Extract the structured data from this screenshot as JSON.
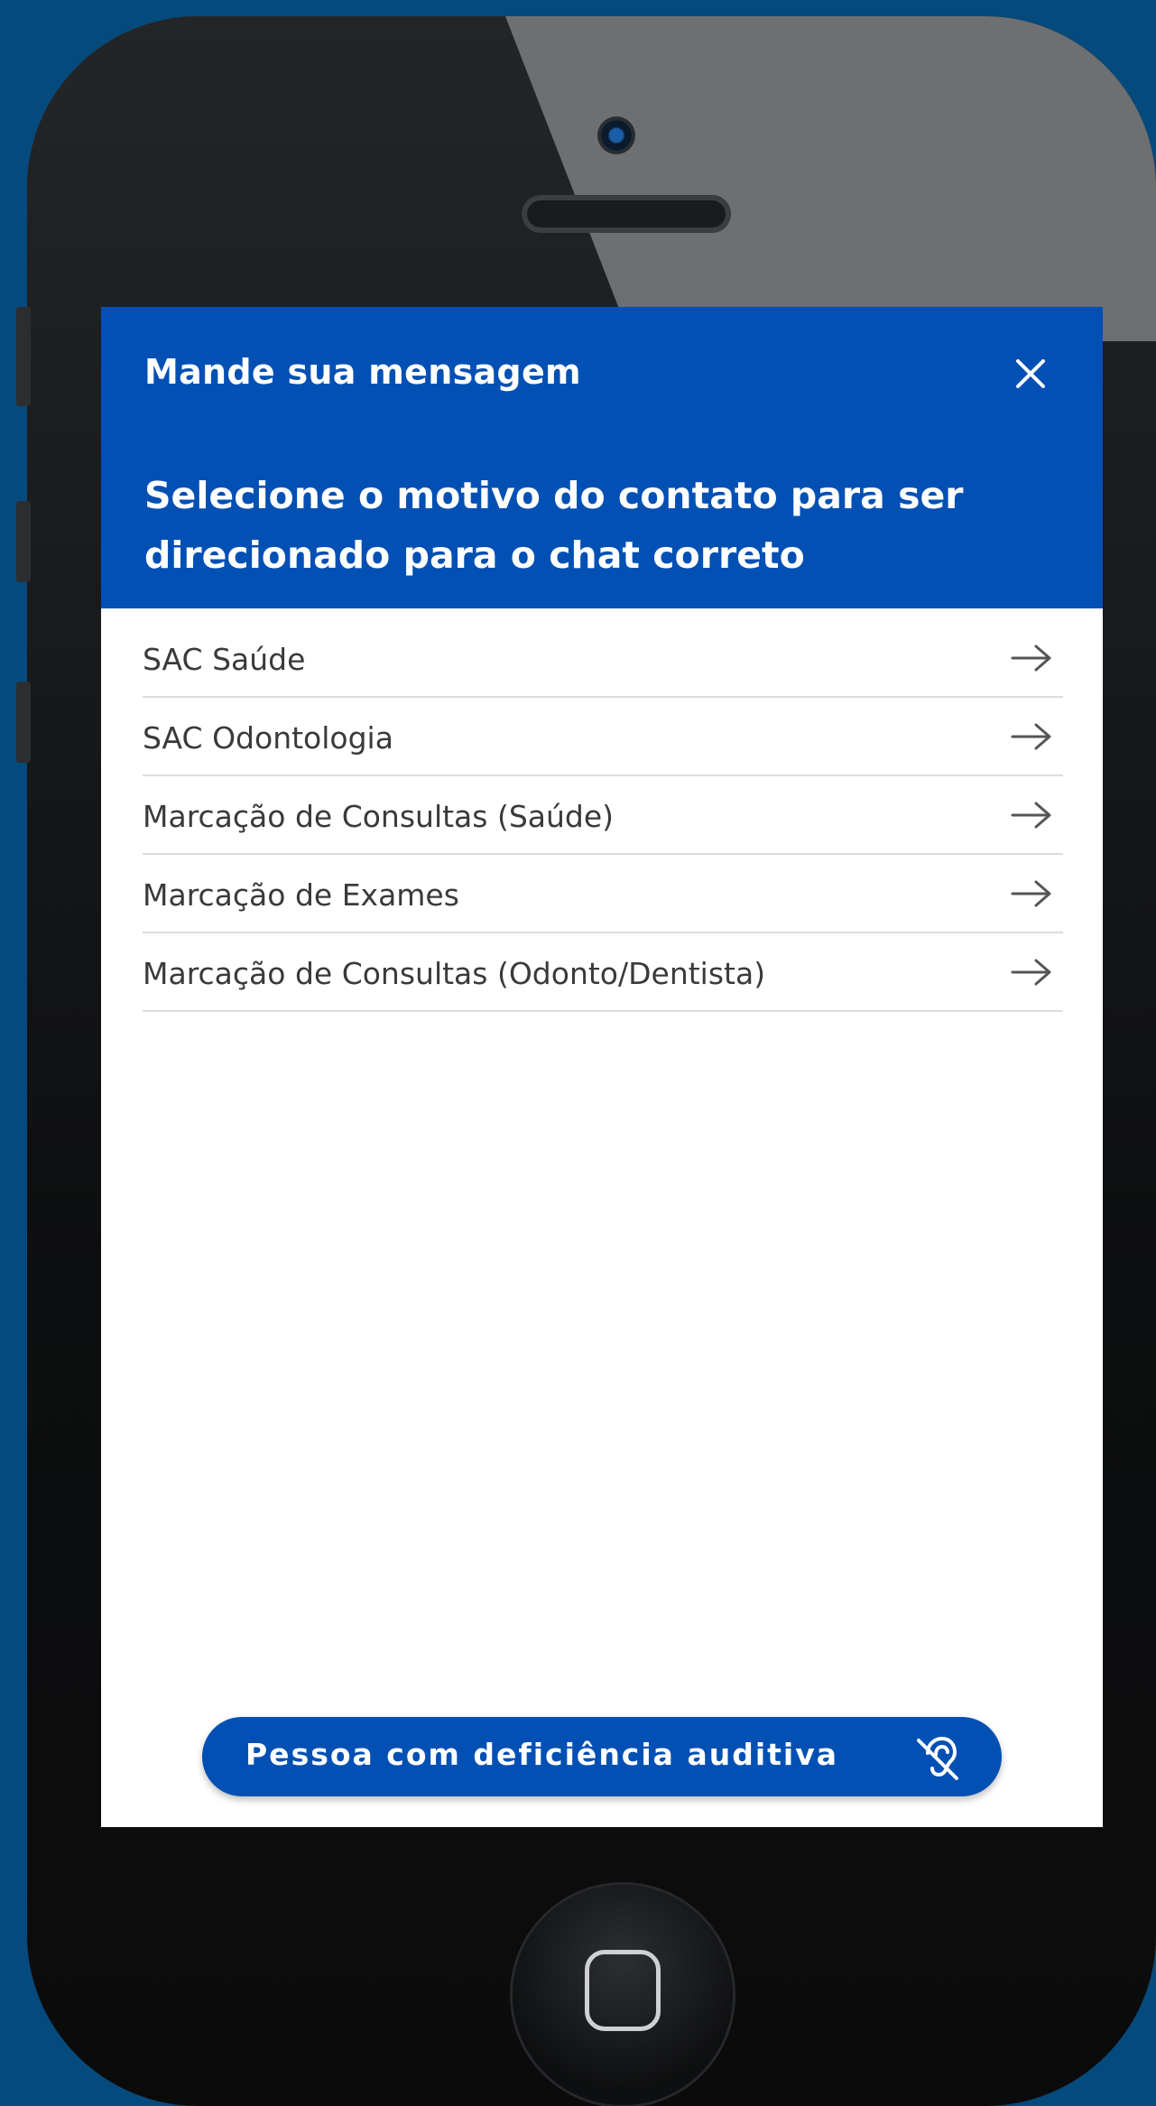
{
  "modal": {
    "title": "Mande sua mensagem",
    "subtitle": "Selecione o motivo do contato para ser direcionado para o chat correto"
  },
  "options": [
    {
      "label": "SAC Saúde"
    },
    {
      "label": "SAC Odontologia"
    },
    {
      "label": "Marcação de Consultas (Saúde)"
    },
    {
      "label": "Marcação de Exames"
    },
    {
      "label": "Marcação de Consultas (Odonto/Dentista)"
    }
  ],
  "accessibility_button": {
    "label": "Pessoa com deficiência auditiva",
    "icon": "hearing-impaired-icon"
  },
  "colors": {
    "brand_blue": "#0250b4",
    "background": "#054a7c"
  }
}
